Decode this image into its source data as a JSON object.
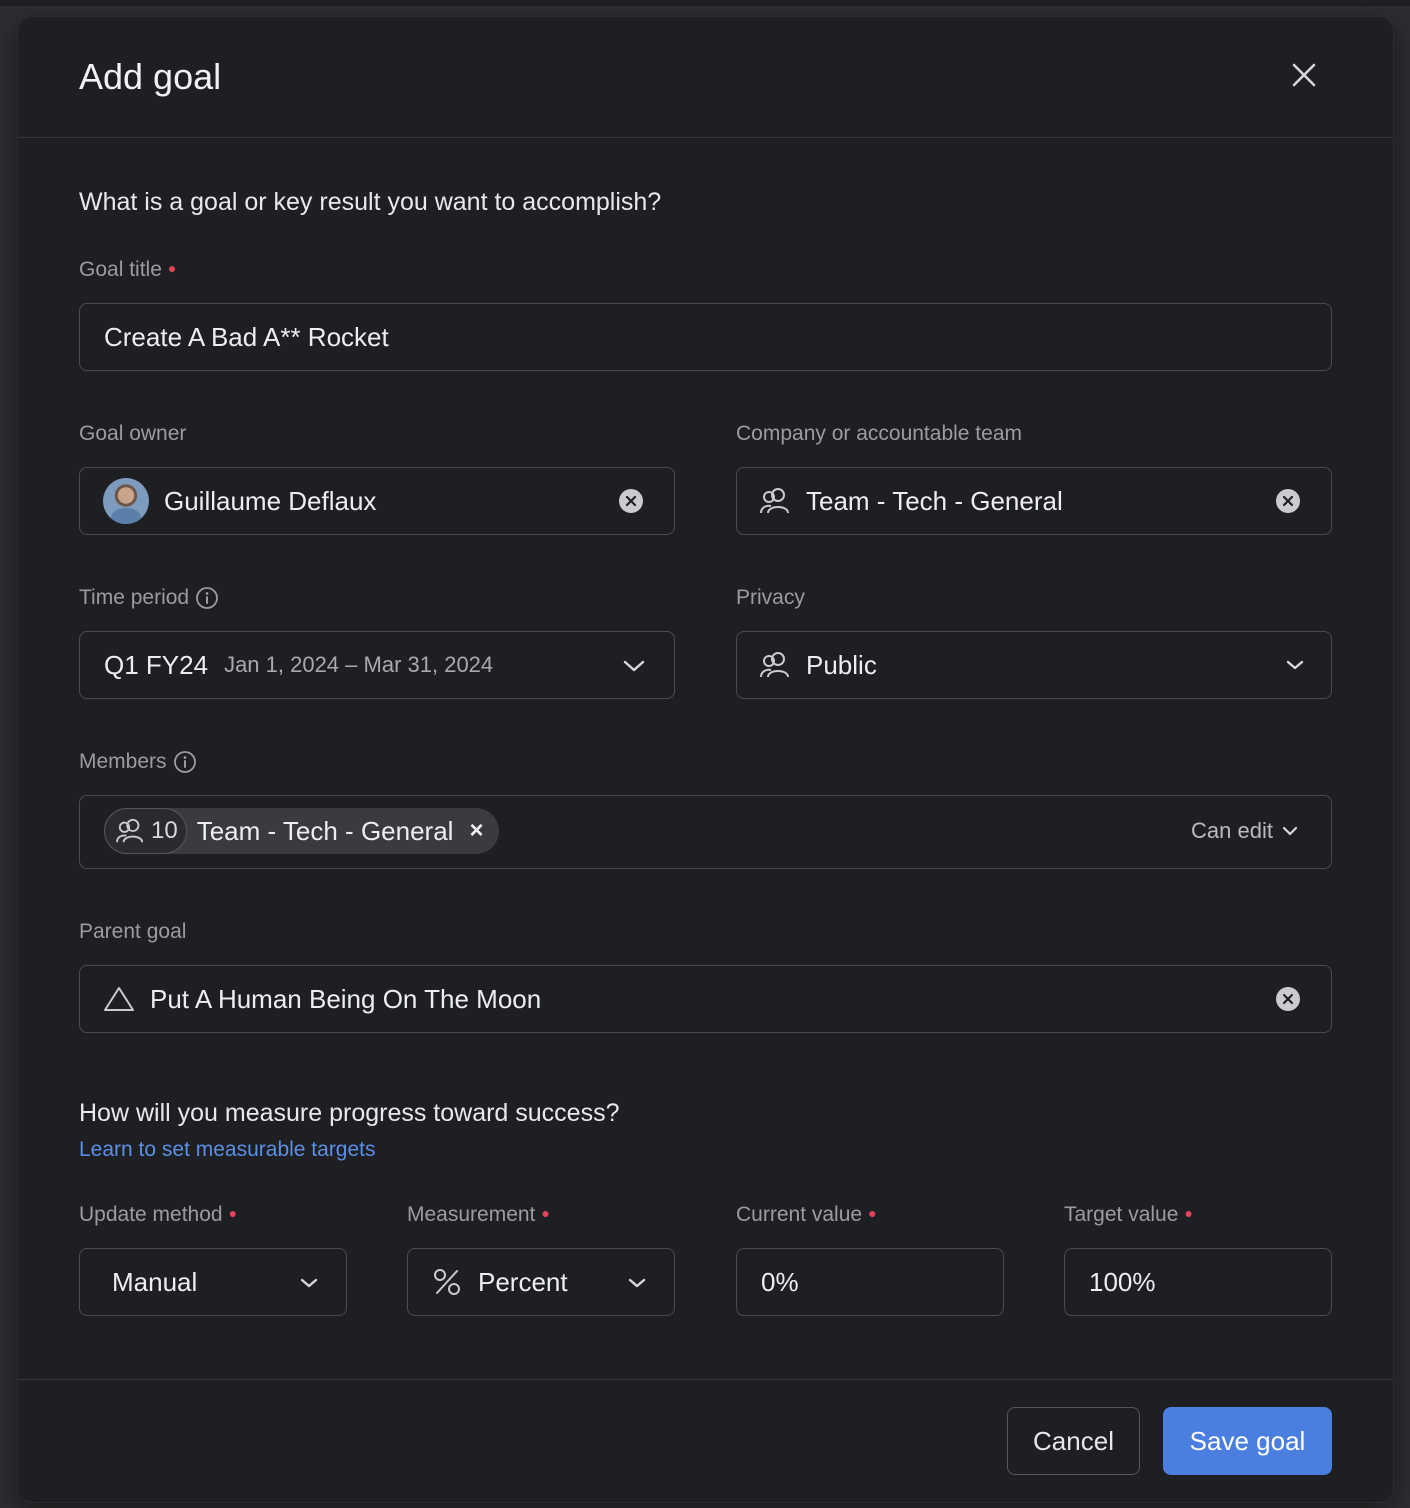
{
  "modal": {
    "title": "Add goal",
    "close_icon": "close-icon"
  },
  "intro": {
    "question": "What is a goal or key result you want to accomplish?"
  },
  "goal_title": {
    "label": "Goal title",
    "value": "Create A Bad A** Rocket"
  },
  "goal_owner": {
    "label": "Goal owner",
    "value": "Guillaume Deflaux"
  },
  "company_team": {
    "label": "Company or accountable team",
    "value": "Team - Tech - General"
  },
  "time_period": {
    "label": "Time period",
    "value": "Q1 FY24",
    "range": "Jan 1, 2024 – Mar 31, 2024"
  },
  "privacy": {
    "label": "Privacy",
    "value": "Public"
  },
  "members": {
    "label": "Members",
    "chip": {
      "count": "10",
      "name": "Team - Tech - General",
      "remove": "×"
    },
    "permission": "Can edit"
  },
  "parent_goal": {
    "label": "Parent goal",
    "value": "Put A Human Being On The Moon"
  },
  "measure": {
    "question": "How will you measure progress toward success?",
    "link": "Learn to set measurable targets",
    "update_method": {
      "label": "Update method",
      "value": "Manual"
    },
    "measurement": {
      "label": "Measurement",
      "value": "Percent"
    },
    "current_value": {
      "label": "Current value",
      "value": "0%"
    },
    "target_value": {
      "label": "Target value",
      "value": "100%"
    }
  },
  "footer": {
    "cancel": "Cancel",
    "save": "Save goal"
  },
  "colors": {
    "accent": "#4a7fe0",
    "required": "#e2445c",
    "link": "#5b8fe6",
    "surface": "#1e1f22"
  }
}
